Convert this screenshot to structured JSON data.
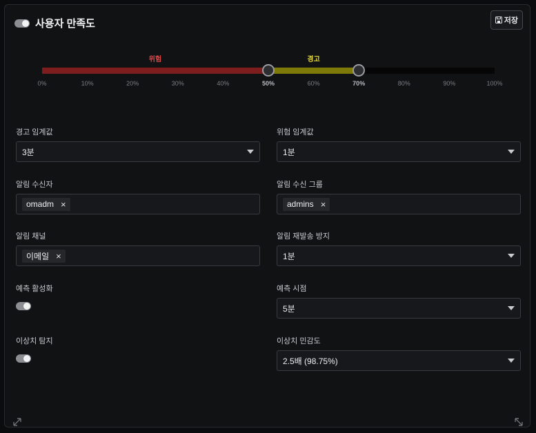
{
  "header": {
    "title": "사용자 만족도",
    "save_label": "저장"
  },
  "thresholds": {
    "danger_label": "위험",
    "warning_label": "경고",
    "danger_percent": 50,
    "warning_percent": 70,
    "colors": {
      "danger": "#7d1d1d",
      "warning": "#7d7a0a",
      "danger_text": "#e04848",
      "warning_text": "#e8d93a"
    },
    "ticks": [
      "0%",
      "10%",
      "20%",
      "30%",
      "40%",
      "50%",
      "60%",
      "70%",
      "80%",
      "90%",
      "100%"
    ]
  },
  "form": {
    "warning_threshold": {
      "label": "경고 임계값",
      "value": "3분"
    },
    "danger_threshold": {
      "label": "위험 임계값",
      "value": "1분"
    },
    "recipients": {
      "label": "알림 수신자",
      "chip": "omadm"
    },
    "recipient_groups": {
      "label": "알림 수신 그룹",
      "chip": "admins"
    },
    "channels": {
      "label": "알림 채널",
      "chip": "이메일"
    },
    "resend_prevention": {
      "label": "알림 재발송 방지",
      "value": "1분"
    },
    "prediction_enabled": {
      "label": "예측 활성화"
    },
    "prediction_time": {
      "label": "예측 시점",
      "value": "5분"
    },
    "anomaly_detection": {
      "label": "이상치 탐지"
    },
    "anomaly_sensitivity": {
      "label": "이상치 민감도",
      "value": "2.5배 (98.75%)"
    }
  },
  "icons": {
    "remove": "×"
  }
}
